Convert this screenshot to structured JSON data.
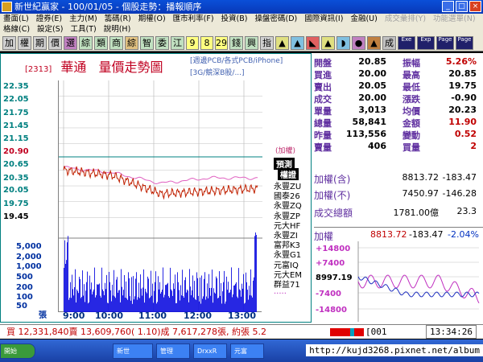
{
  "window": {
    "title": "新世紀贏家 - 100/01/05 - 個股走勢：播報順序"
  },
  "menu": {
    "row1": [
      "畫面(L)",
      "證券(E)",
      "主力(M)",
      "籌碼(R)",
      "期權(O)",
      "匯市利率(F)",
      "投資(B)",
      "操盤密碼(D)",
      "國際資訊(I)",
      "金融(U)",
      "成交彙排(Y)",
      "功能選單(N)"
    ],
    "row2": [
      "格線(C)",
      "設定(S)",
      "工具(T)",
      "說明(H)"
    ]
  },
  "toolbar": {
    "buttons": [
      "加",
      "權",
      "期",
      "價",
      "選",
      "綜",
      "類",
      "商",
      "綜",
      "智",
      "委",
      "江",
      "9",
      "8",
      "29",
      "錢",
      "興",
      "指",
      "▲",
      "▲",
      "◣",
      "▲",
      "◗",
      "●",
      "▲",
      "成",
      "Exe",
      "Exp",
      "Page",
      "Page"
    ]
  },
  "stock": {
    "code": "[2313]",
    "name": "華通",
    "chart_title": "量價走勢圖",
    "tags_line1": "[週邊PCB/各式PCB/iPhone]",
    "tags_line2": "[3G/競深B股/...]"
  },
  "chart": {
    "price_labels": [
      "22.35",
      "22.05",
      "21.75",
      "21.45",
      "21.15",
      "20.90",
      "20.65",
      "20.35",
      "20.05",
      "19.75",
      "19.45"
    ],
    "volume_labels": [
      "5,000",
      "2,000",
      "1,000",
      "500",
      "200",
      "100",
      "50",
      "張"
    ],
    "time_labels": [
      "9:00",
      "10:00",
      "11:00",
      "12:00",
      "13:00"
    ],
    "tag_weighted": "(加權)",
    "tag_pre": "預測",
    "tag_weighted_box": "權證"
  },
  "chart_data": {
    "type": "line",
    "x": [
      "9:00",
      "10:00",
      "11:00",
      "12:00",
      "13:00"
    ],
    "series": [
      {
        "values": [
          20.65,
          20.55,
          20.2,
          20.25,
          20.3
        ]
      },
      {
        "values": [
          20.7,
          20.6,
          20.4,
          20.5,
          20.5
        ]
      }
    ],
    "ylim": [
      19.45,
      22.35
    ]
  },
  "brokers": [
    "永豐ZU",
    "國泰26",
    "永豐ZQ",
    "永豐ZP",
    "元大HF",
    "永豐ZI",
    "富邦K3",
    "永豐G1",
    "元富IQ",
    "元大EM",
    "群益71",
    "....."
  ],
  "quote": {
    "rows": [
      {
        "k1": "開盤",
        "v1": "20.85",
        "k2": "振幅",
        "v2": "5.26%",
        "c2": "#c00000"
      },
      {
        "k1": "買進",
        "v1": "20.00",
        "k2": "最高",
        "v2": "20.85",
        "c2": "#000000"
      },
      {
        "k1": "賣出",
        "v1": "20.05",
        "k2": "最低",
        "v2": "19.75",
        "c2": "#000000"
      },
      {
        "k1": "成交",
        "v1": "20.00",
        "k2": "漲跌",
        "v2": "-0.90",
        "c2": "#000000"
      },
      {
        "k1": "單量",
        "v1": "3,013",
        "k2": "均價",
        "v2": "20.23",
        "c2": "#000000"
      },
      {
        "k1": "總量",
        "v1": "58,841",
        "k2": "金額",
        "v2": "11.90",
        "c2": "#c00000"
      },
      {
        "k1": "昨量",
        "v1": "113,556",
        "k2": "變動",
        "v2": "0.52",
        "c2": "#c00000"
      },
      {
        "k1": "賣量",
        "v1": "406",
        "k2": "買量",
        "v2": "2",
        "c2": "#c00000"
      }
    ]
  },
  "index": {
    "row1": {
      "label": "加權(含)",
      "v1": "8813.72",
      "v2": "-183.47"
    },
    "row2": {
      "label": "加權(不)",
      "v1": "7450.97",
      "v2": "-146.28"
    },
    "row3": {
      "label": "成交總額",
      "v1": "1781.00億",
      "v2": "23.3"
    }
  },
  "mini": {
    "label": "加權",
    "value": "8813.72",
    "change": "-183.47",
    "pct": "-2.04%",
    "ticks": [
      "+14800",
      "+7400",
      "8997.19",
      "-7400",
      "-14800"
    ]
  },
  "status": {
    "text": "買 12,331,840賣 13,609,760( 1.10)成 7,617,278張, 約張 5.2",
    "input": "001",
    "time": "13:34:26"
  },
  "taskbar": {
    "items": [
      "開始",
      "新世",
      "管理",
      "DrxxR",
      "元富"
    ]
  },
  "watermark": "http://kujd3268.pixnet.net/album"
}
